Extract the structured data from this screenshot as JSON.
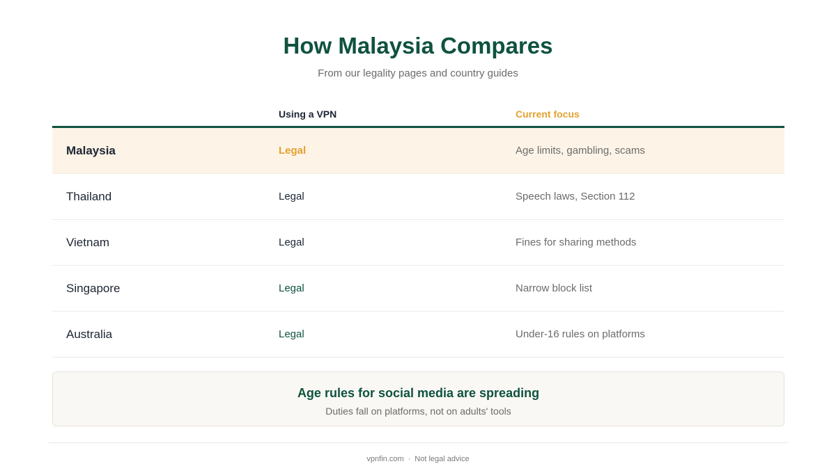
{
  "header": {
    "title": "How Malaysia Compares",
    "subtitle": "From our legality pages and country guides"
  },
  "table": {
    "columns": [
      "",
      "Using a VPN",
      "Current focus"
    ],
    "rows": [
      {
        "country": "Malaysia",
        "vpn": "Legal",
        "focus": "Age limits, gambling, scams",
        "highlight": true
      },
      {
        "country": "Thailand",
        "vpn": "Legal",
        "focus": "Speech laws, Section 112"
      },
      {
        "country": "Vietnam",
        "vpn": "Legal",
        "focus": "Fines for sharing methods"
      },
      {
        "country": "Singapore",
        "vpn": "Legal",
        "focus": "Narrow block list"
      },
      {
        "country": "Australia",
        "vpn": "Legal",
        "focus": "Under-16 rules on platforms"
      }
    ]
  },
  "callout": {
    "title": "Age rules for social media are spreading",
    "subtitle": "Duties fall on platforms, not on adults' tools"
  },
  "footer": {
    "site": "vpnfin.com",
    "separator": "·",
    "note": "Not legal advice"
  },
  "colors": {
    "brand_green": "#0f5240",
    "accent_amber": "#e3a12f",
    "highlight_bg": "#fdf4e7"
  }
}
